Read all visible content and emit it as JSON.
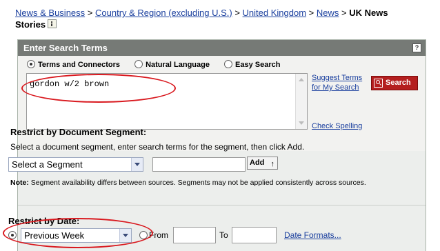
{
  "breadcrumb": {
    "links": [
      "News & Business",
      "Country & Region (excluding U.S.)",
      "United Kingdom",
      "News"
    ],
    "separator": ">",
    "current_line1": "UK News",
    "current_line2": "Stories"
  },
  "panel": {
    "title": "Enter Search Terms",
    "help_label": "?"
  },
  "search_mode": {
    "options": [
      "Terms and Connectors",
      "Natural Language",
      "Easy Search"
    ],
    "selected": "Terms and Connectors"
  },
  "terms": {
    "value": "gordon w/2 brown"
  },
  "links": {
    "suggest_terms": "Suggest Terms",
    "suggest_terms_2": "for My Search",
    "check_spelling": "Check Spelling"
  },
  "search_button": {
    "label": "Search",
    "color": "#b41f1f"
  },
  "segment": {
    "title": "Restrict by Document Segment:",
    "description": "Select a document segment, enter search terms for the segment, then click Add.",
    "select_value": "Select a Segment",
    "add_label": "Add",
    "note_label": "Note:",
    "note_text": " Segment availability differs between sources. Segments may not be applied consistently across sources."
  },
  "date": {
    "title": "Restrict by Date:",
    "select_value": "Previous Week",
    "from_label": "From",
    "to_label": "To",
    "formats_link": "Date Formats..."
  },
  "highlight_color": "#d9191f"
}
